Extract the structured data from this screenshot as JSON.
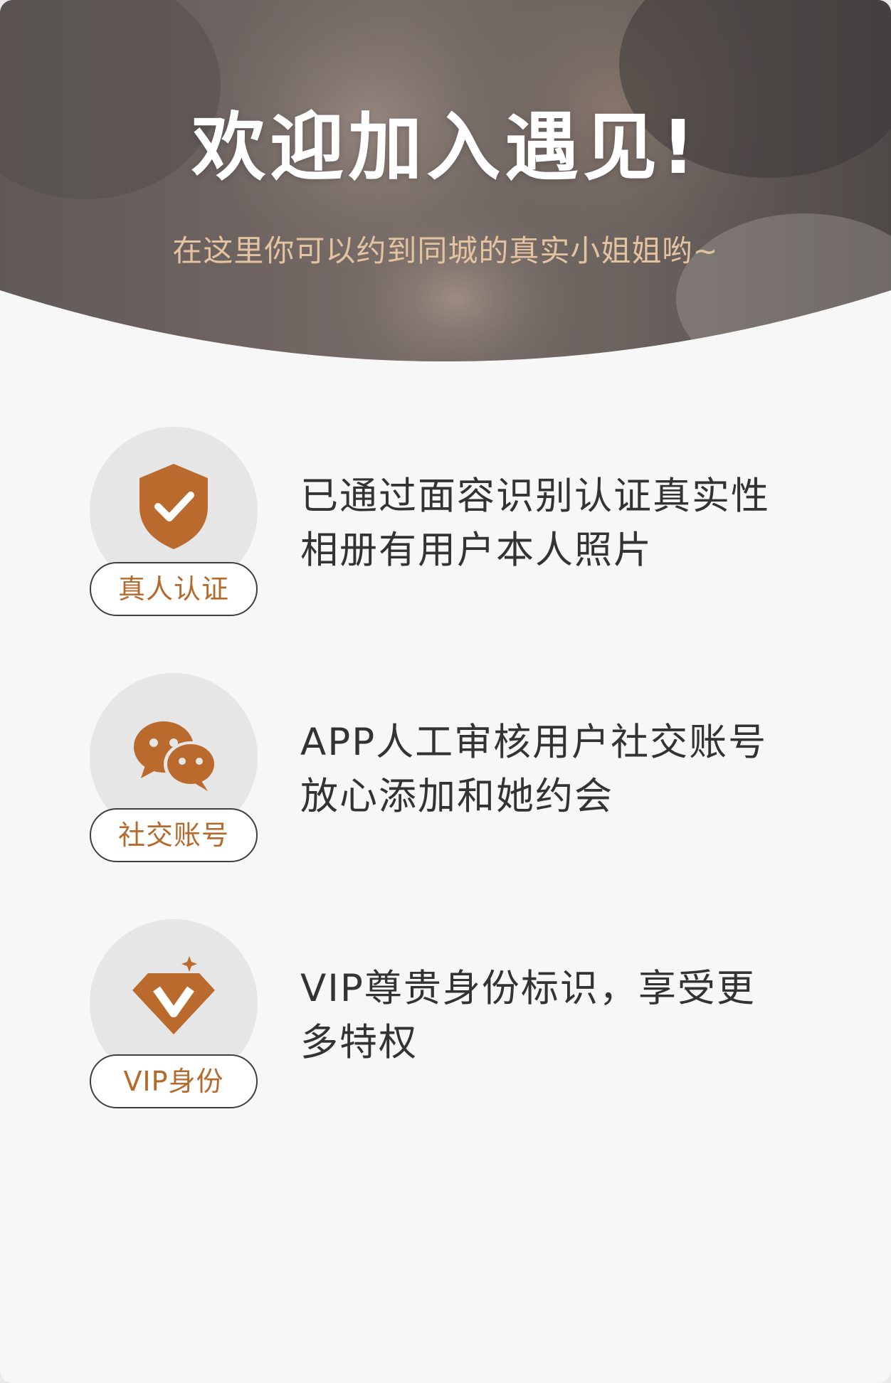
{
  "hero": {
    "title": "欢迎加入遇见!",
    "subtitle": "在这里你可以约到同城的真实小姐姐哟~"
  },
  "features": [
    {
      "icon": "shield-check-icon",
      "badge": "真人认证",
      "lines": [
        "已通过面容识别认证真实性",
        "相册有用户本人照片"
      ]
    },
    {
      "icon": "wechat-icon",
      "badge": "社交账号",
      "lines": [
        "APP人工审核用户社交账号",
        "放心添加和她约会"
      ]
    },
    {
      "icon": "diamond-v-icon",
      "badge": "VIP身份",
      "lines": [
        "VIP尊贵身份标识，享受更",
        "多特权"
      ]
    }
  ],
  "colors": {
    "accent": "#b96a2c",
    "background": "#f7f7f7",
    "circle": "#e6e6e6",
    "subtitle": "#e3c3a0",
    "text": "#333333"
  }
}
